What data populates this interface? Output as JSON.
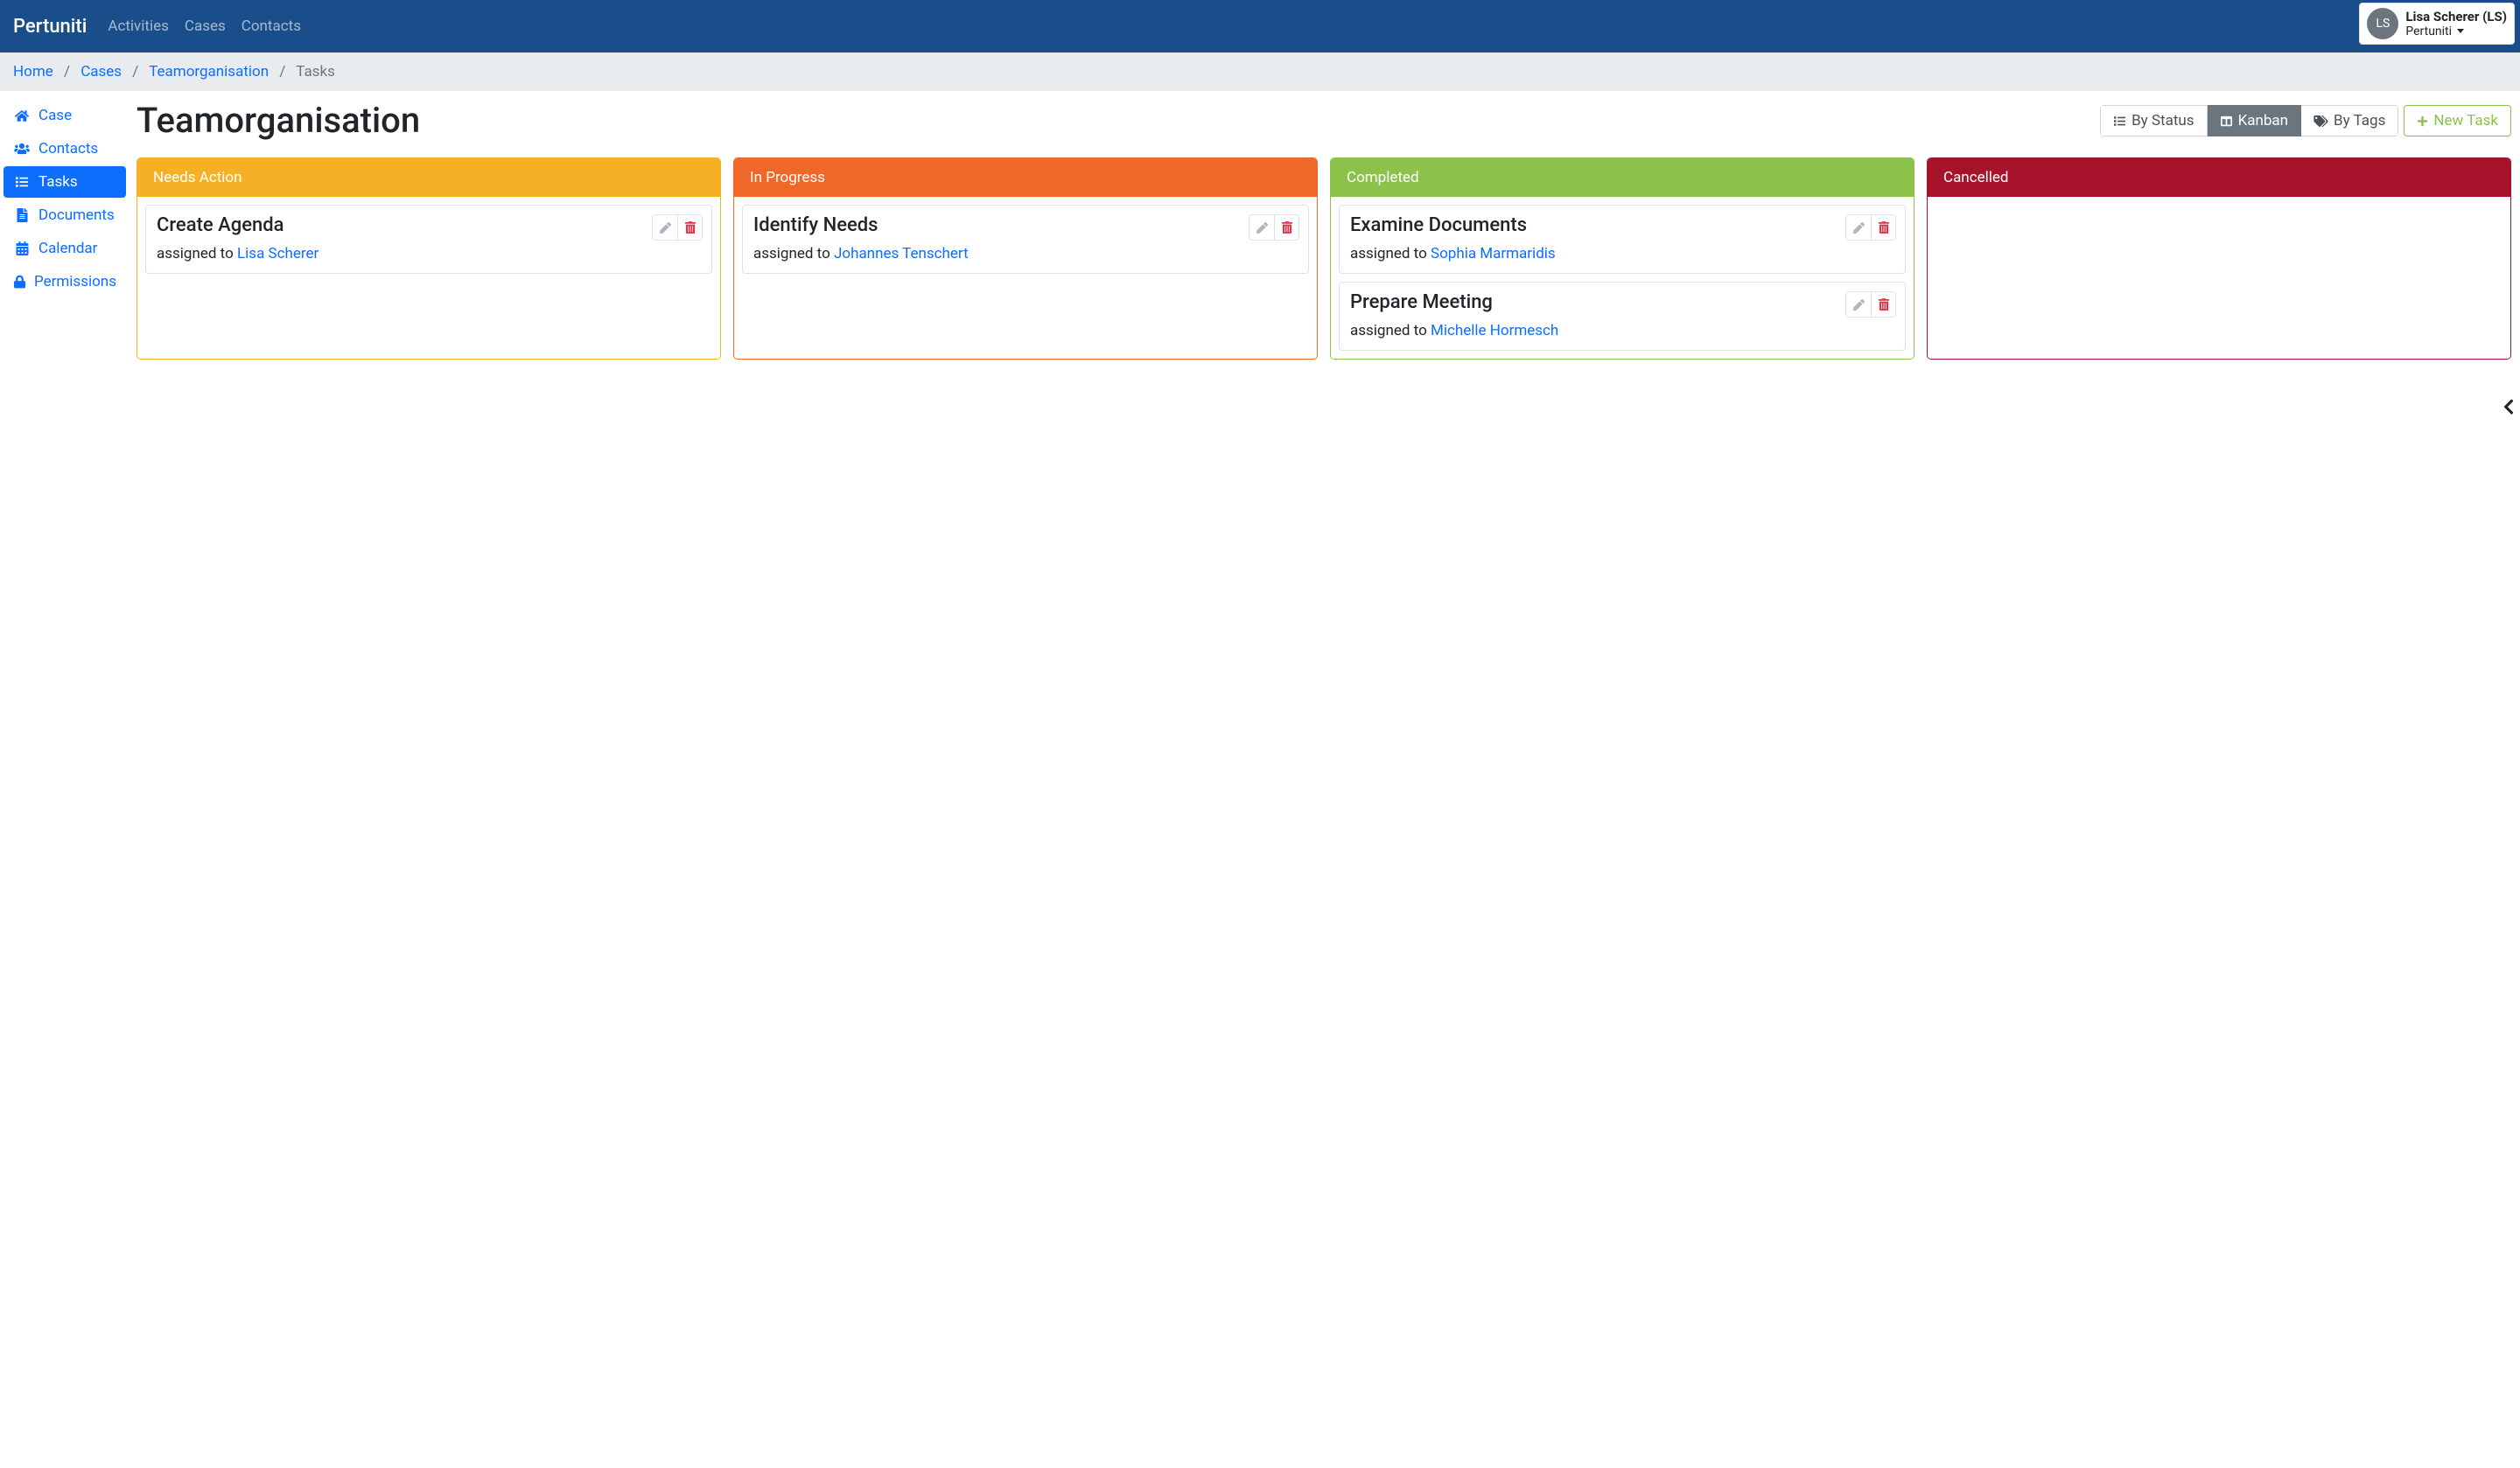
{
  "navbar": {
    "brand": "Pertuniti",
    "links": [
      "Activities",
      "Cases",
      "Contacts"
    ]
  },
  "user": {
    "initials": "LS",
    "display": "Lisa Scherer (LS)",
    "org": "Pertuniti"
  },
  "breadcrumb": [
    {
      "label": "Home",
      "active": false
    },
    {
      "label": "Cases",
      "active": false
    },
    {
      "label": "Teamorganisation",
      "active": false
    },
    {
      "label": "Tasks",
      "active": true
    }
  ],
  "sidebar": [
    {
      "icon": "home",
      "label": "Case",
      "active": false
    },
    {
      "icon": "users",
      "label": "Contacts",
      "active": false
    },
    {
      "icon": "list",
      "label": "Tasks",
      "active": true
    },
    {
      "icon": "file",
      "label": "Documents",
      "active": false
    },
    {
      "icon": "calendar",
      "label": "Calendar",
      "active": false
    },
    {
      "icon": "lock",
      "label": "Permissions",
      "active": false
    }
  ],
  "page": {
    "title": "Teamorganisation"
  },
  "viewButtons": [
    {
      "icon": "list",
      "label": "By Status",
      "active": false
    },
    {
      "icon": "columns",
      "label": "Kanban",
      "active": true
    },
    {
      "icon": "tags",
      "label": "By Tags",
      "active": false
    }
  ],
  "newTask": {
    "label": "New Task"
  },
  "assignedPrefix": "assigned to ",
  "columns": [
    {
      "key": "needs",
      "title": "Needs Action",
      "cards": [
        {
          "title": "Create Agenda",
          "assignee": "Lisa Scherer"
        }
      ]
    },
    {
      "key": "progress",
      "title": "In Progress",
      "cards": [
        {
          "title": "Identify Needs",
          "assignee": "Johannes Tenschert"
        }
      ]
    },
    {
      "key": "completed",
      "title": "Completed",
      "cards": [
        {
          "title": "Examine Documents",
          "assignee": "Sophia Marmaridis"
        },
        {
          "title": "Prepare Meeting",
          "assignee": "Michelle Hormesch"
        }
      ]
    },
    {
      "key": "cancelled",
      "title": "Cancelled",
      "cards": []
    }
  ]
}
